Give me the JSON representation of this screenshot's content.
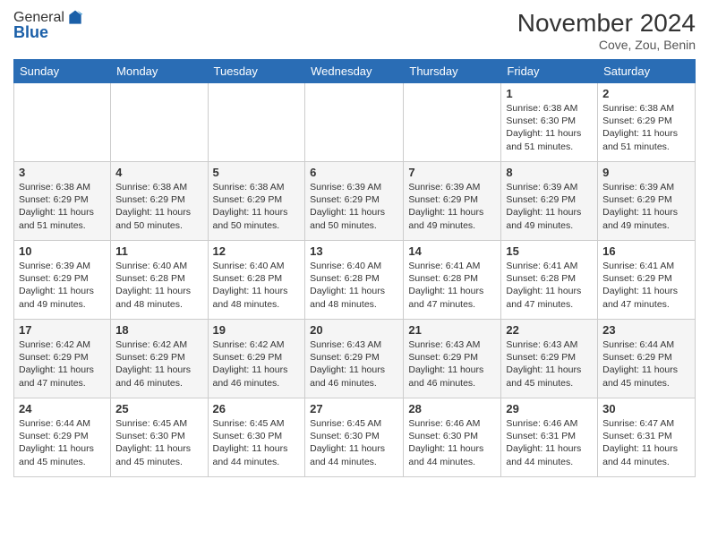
{
  "logo": {
    "general": "General",
    "blue": "Blue"
  },
  "header": {
    "title": "November 2024",
    "location": "Cove, Zou, Benin"
  },
  "weekdays": [
    "Sunday",
    "Monday",
    "Tuesday",
    "Wednesday",
    "Thursday",
    "Friday",
    "Saturday"
  ],
  "weeks": [
    [
      {
        "day": "",
        "info": ""
      },
      {
        "day": "",
        "info": ""
      },
      {
        "day": "",
        "info": ""
      },
      {
        "day": "",
        "info": ""
      },
      {
        "day": "",
        "info": ""
      },
      {
        "day": "1",
        "info": "Sunrise: 6:38 AM\nSunset: 6:30 PM\nDaylight: 11 hours and 51 minutes."
      },
      {
        "day": "2",
        "info": "Sunrise: 6:38 AM\nSunset: 6:29 PM\nDaylight: 11 hours and 51 minutes."
      }
    ],
    [
      {
        "day": "3",
        "info": "Sunrise: 6:38 AM\nSunset: 6:29 PM\nDaylight: 11 hours and 51 minutes."
      },
      {
        "day": "4",
        "info": "Sunrise: 6:38 AM\nSunset: 6:29 PM\nDaylight: 11 hours and 50 minutes."
      },
      {
        "day": "5",
        "info": "Sunrise: 6:38 AM\nSunset: 6:29 PM\nDaylight: 11 hours and 50 minutes."
      },
      {
        "day": "6",
        "info": "Sunrise: 6:39 AM\nSunset: 6:29 PM\nDaylight: 11 hours and 50 minutes."
      },
      {
        "day": "7",
        "info": "Sunrise: 6:39 AM\nSunset: 6:29 PM\nDaylight: 11 hours and 49 minutes."
      },
      {
        "day": "8",
        "info": "Sunrise: 6:39 AM\nSunset: 6:29 PM\nDaylight: 11 hours and 49 minutes."
      },
      {
        "day": "9",
        "info": "Sunrise: 6:39 AM\nSunset: 6:29 PM\nDaylight: 11 hours and 49 minutes."
      }
    ],
    [
      {
        "day": "10",
        "info": "Sunrise: 6:39 AM\nSunset: 6:29 PM\nDaylight: 11 hours and 49 minutes."
      },
      {
        "day": "11",
        "info": "Sunrise: 6:40 AM\nSunset: 6:28 PM\nDaylight: 11 hours and 48 minutes."
      },
      {
        "day": "12",
        "info": "Sunrise: 6:40 AM\nSunset: 6:28 PM\nDaylight: 11 hours and 48 minutes."
      },
      {
        "day": "13",
        "info": "Sunrise: 6:40 AM\nSunset: 6:28 PM\nDaylight: 11 hours and 48 minutes."
      },
      {
        "day": "14",
        "info": "Sunrise: 6:41 AM\nSunset: 6:28 PM\nDaylight: 11 hours and 47 minutes."
      },
      {
        "day": "15",
        "info": "Sunrise: 6:41 AM\nSunset: 6:28 PM\nDaylight: 11 hours and 47 minutes."
      },
      {
        "day": "16",
        "info": "Sunrise: 6:41 AM\nSunset: 6:29 PM\nDaylight: 11 hours and 47 minutes."
      }
    ],
    [
      {
        "day": "17",
        "info": "Sunrise: 6:42 AM\nSunset: 6:29 PM\nDaylight: 11 hours and 47 minutes."
      },
      {
        "day": "18",
        "info": "Sunrise: 6:42 AM\nSunset: 6:29 PM\nDaylight: 11 hours and 46 minutes."
      },
      {
        "day": "19",
        "info": "Sunrise: 6:42 AM\nSunset: 6:29 PM\nDaylight: 11 hours and 46 minutes."
      },
      {
        "day": "20",
        "info": "Sunrise: 6:43 AM\nSunset: 6:29 PM\nDaylight: 11 hours and 46 minutes."
      },
      {
        "day": "21",
        "info": "Sunrise: 6:43 AM\nSunset: 6:29 PM\nDaylight: 11 hours and 46 minutes."
      },
      {
        "day": "22",
        "info": "Sunrise: 6:43 AM\nSunset: 6:29 PM\nDaylight: 11 hours and 45 minutes."
      },
      {
        "day": "23",
        "info": "Sunrise: 6:44 AM\nSunset: 6:29 PM\nDaylight: 11 hours and 45 minutes."
      }
    ],
    [
      {
        "day": "24",
        "info": "Sunrise: 6:44 AM\nSunset: 6:29 PM\nDaylight: 11 hours and 45 minutes."
      },
      {
        "day": "25",
        "info": "Sunrise: 6:45 AM\nSunset: 6:30 PM\nDaylight: 11 hours and 45 minutes."
      },
      {
        "day": "26",
        "info": "Sunrise: 6:45 AM\nSunset: 6:30 PM\nDaylight: 11 hours and 44 minutes."
      },
      {
        "day": "27",
        "info": "Sunrise: 6:45 AM\nSunset: 6:30 PM\nDaylight: 11 hours and 44 minutes."
      },
      {
        "day": "28",
        "info": "Sunrise: 6:46 AM\nSunset: 6:30 PM\nDaylight: 11 hours and 44 minutes."
      },
      {
        "day": "29",
        "info": "Sunrise: 6:46 AM\nSunset: 6:31 PM\nDaylight: 11 hours and 44 minutes."
      },
      {
        "day": "30",
        "info": "Sunrise: 6:47 AM\nSunset: 6:31 PM\nDaylight: 11 hours and 44 minutes."
      }
    ]
  ]
}
